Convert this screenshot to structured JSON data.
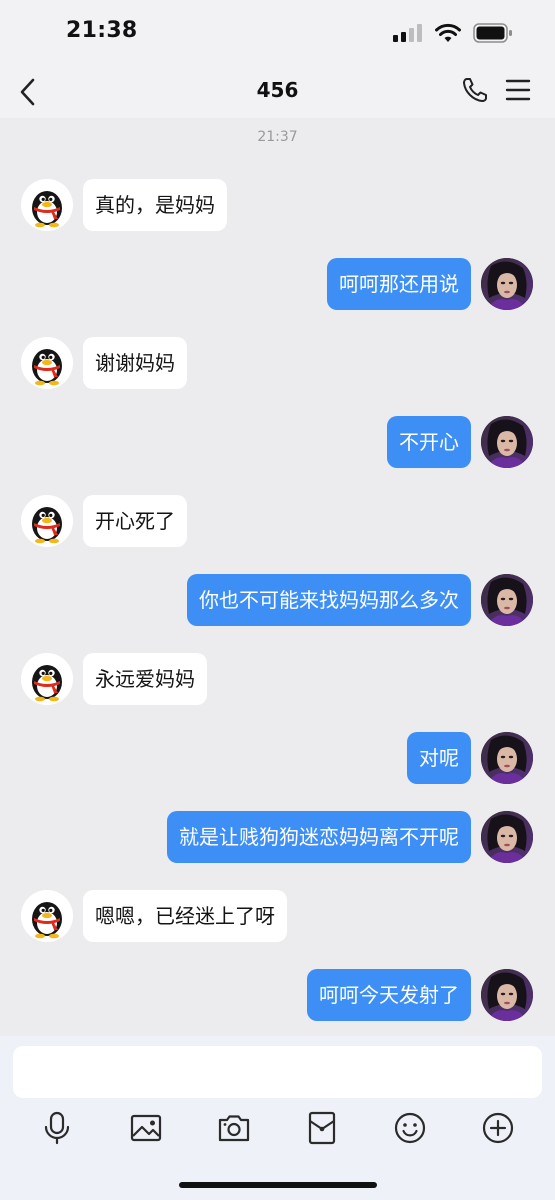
{
  "status_bar": {
    "time": "21:38"
  },
  "header": {
    "title": "456",
    "back_icon": "chevron-left-icon",
    "call_icon": "phone-icon",
    "menu_icon": "hamburger-menu-icon"
  },
  "chat": {
    "timestamp": "21:37",
    "messages": [
      {
        "side": "left",
        "text": "真的，是妈妈",
        "avatar": "qq-penguin"
      },
      {
        "side": "right",
        "text": "呵呵那还用说",
        "avatar": "user-photo"
      },
      {
        "side": "left",
        "text": "谢谢妈妈",
        "avatar": "qq-penguin"
      },
      {
        "side": "right",
        "text": "不开心",
        "avatar": "user-photo"
      },
      {
        "side": "left",
        "text": "开心死了",
        "avatar": "qq-penguin"
      },
      {
        "side": "right",
        "text": "你也不可能来找妈妈那么多次",
        "avatar": "user-photo"
      },
      {
        "side": "left",
        "text": "永远爱妈妈",
        "avatar": "qq-penguin"
      },
      {
        "side": "right",
        "text": "对呢",
        "avatar": "user-photo"
      },
      {
        "side": "right",
        "text": "就是让贱狗狗迷恋妈妈离不开呢",
        "avatar": "user-photo"
      },
      {
        "side": "left",
        "text": "嗯嗯，已经迷上了呀",
        "avatar": "qq-penguin"
      },
      {
        "side": "right",
        "text": "呵呵今天发射了",
        "avatar": "user-photo"
      }
    ]
  },
  "input": {
    "value": "",
    "placeholder": ""
  },
  "toolbar": {
    "items": [
      "microphone-icon",
      "image-icon",
      "camera-icon",
      "red-packet-icon",
      "emoji-icon",
      "plus-icon"
    ]
  },
  "colors": {
    "outgoing_bubble": "#3d8ff6",
    "incoming_bubble": "#ffffff",
    "chat_background": "#ececee"
  }
}
